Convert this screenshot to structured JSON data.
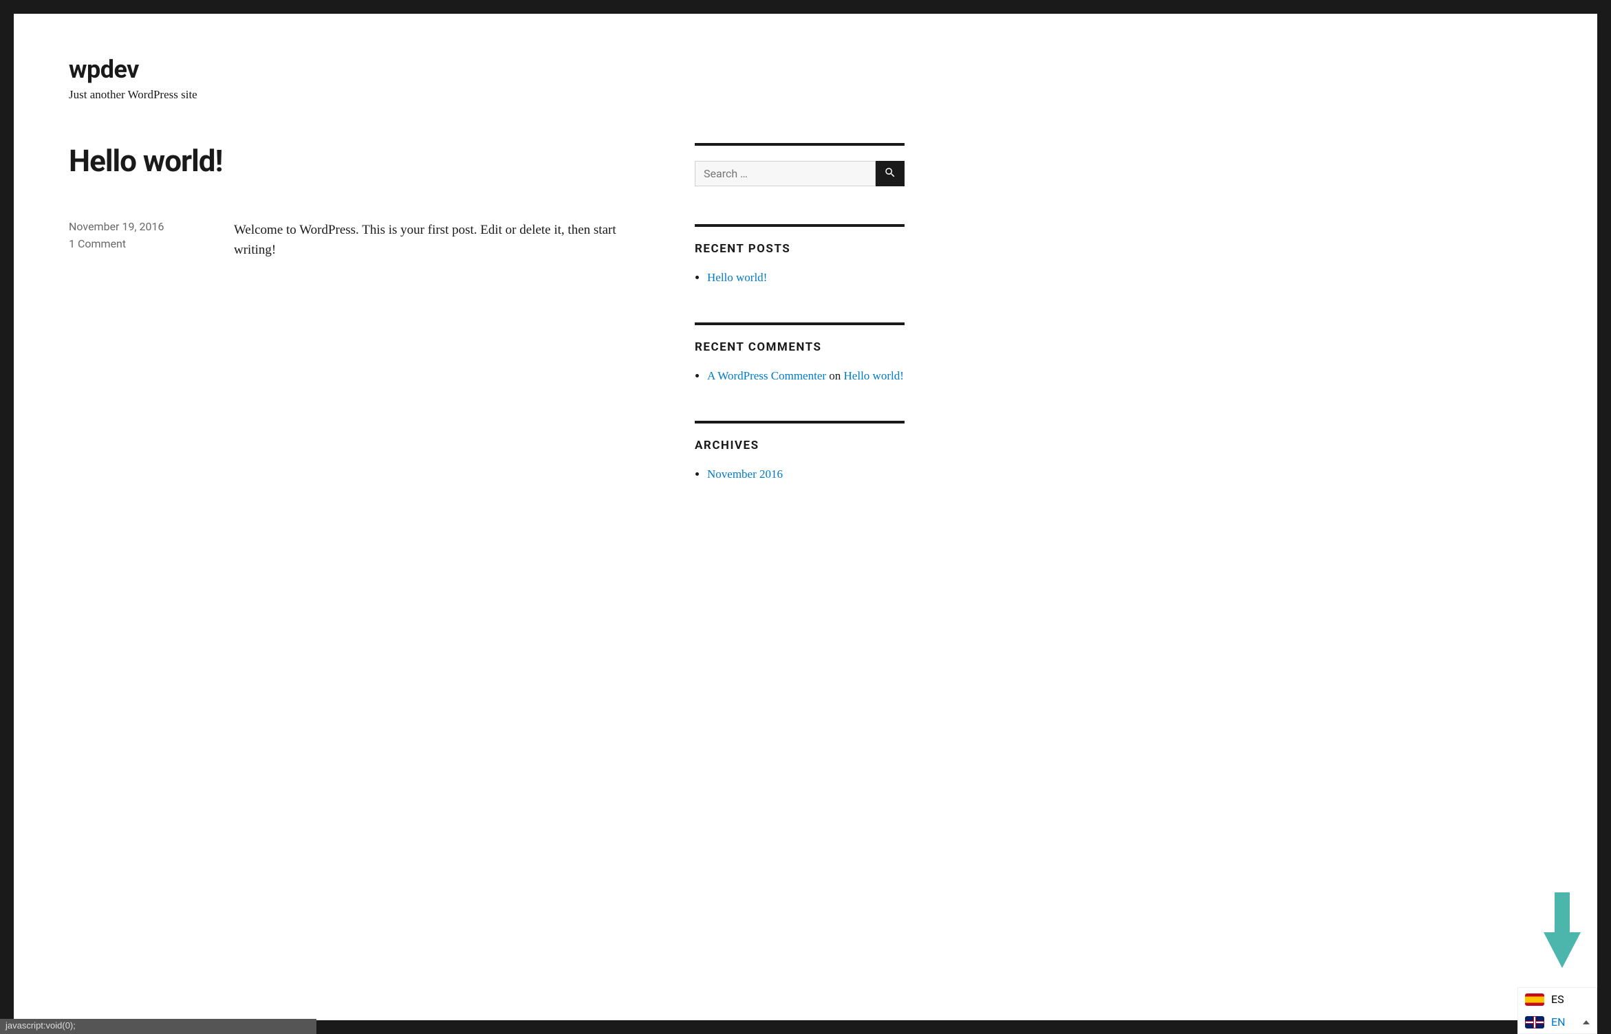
{
  "site": {
    "title": "wpdev",
    "tagline": "Just another WordPress site"
  },
  "post": {
    "title": "Hello world!",
    "date": "November 19, 2016",
    "comments_label": "1 Comment",
    "content": "Welcome to WordPress. This is your first post. Edit or delete it, then start writing!"
  },
  "sidebar": {
    "search_placeholder": "Search …",
    "recent_posts": {
      "heading": "RECENT POSTS",
      "items": [
        "Hello world!"
      ]
    },
    "recent_comments": {
      "heading": "RECENT COMMENTS",
      "author": "A WordPress Commenter",
      "on": " on ",
      "target": "Hello world!"
    },
    "archives": {
      "heading": "ARCHIVES",
      "items": [
        "November 2016"
      ]
    }
  },
  "lang": {
    "es": "ES",
    "en": "EN"
  },
  "status": "javascript:void(0);",
  "colors": {
    "link": "#007acc",
    "arrow": "#4db6ac"
  }
}
